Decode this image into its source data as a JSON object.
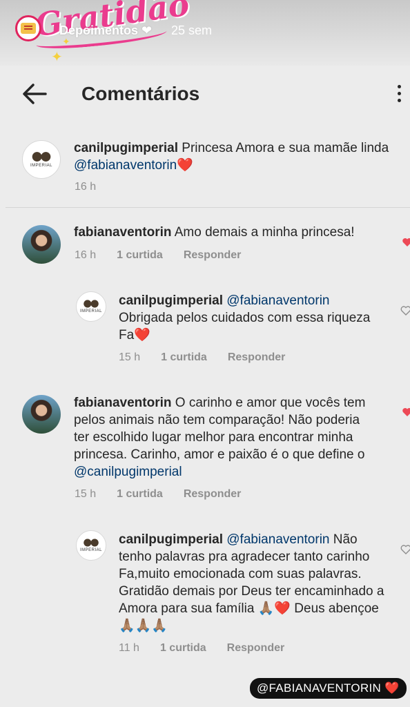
{
  "story": {
    "sticker_text": "Gratidão",
    "title": "Depoimentos ❤",
    "time": "25 sem"
  },
  "header": {
    "title": "Comentários"
  },
  "colors": {
    "like_red": "#ed4956",
    "mention_blue": "#00376b",
    "meta_gray": "#8e8e8e"
  },
  "comments": [
    {
      "username": "canilpugimperial",
      "text": "Princesa Amora e sua mamãe linda ",
      "mention": "@fabianaventorin",
      "emoji": "❤️",
      "time": "16 h"
    },
    {
      "username": "fabianaventorin",
      "text": "Amo demais a minha princesa!",
      "time": "16 h",
      "likes": "1 curtida",
      "reply": "Responder"
    },
    {
      "username": "canilpugimperial",
      "mention": "@fabianaventorin",
      "text": "Obrigada pelos cuidados com essa riqueza Fa",
      "emoji": "❤️",
      "time": "15 h",
      "likes": "1 curtida",
      "reply": "Responder"
    },
    {
      "username": "fabianaventorin",
      "text": "O carinho e amor que vocês tem pelos animais não tem comparação! Não poderia ter escolhido lugar melhor para encontrar minha princesa. Carinho, amor e paixão é o que define o ",
      "mention": "@canilpugimperial",
      "time": "15 h",
      "likes": "1 curtida",
      "reply": "Responder"
    },
    {
      "username": "canilpugimperial",
      "mention": "@fabianaventorin",
      "text": "Não tenho palavras pra agradecer tanto carinho Fa,muito emocionada com suas palavras. Gratidão demais por Deus ter encaminhado a Amora para sua família ",
      "emoji_text": "🙏🏽❤️ Deus abençoe🙏🏽🙏🏽🙏🏽",
      "time": "11 h",
      "likes": "1 curtida",
      "reply": "Responder"
    }
  ],
  "tag": {
    "text": "@FABIANAVENTORIN ❤️"
  }
}
